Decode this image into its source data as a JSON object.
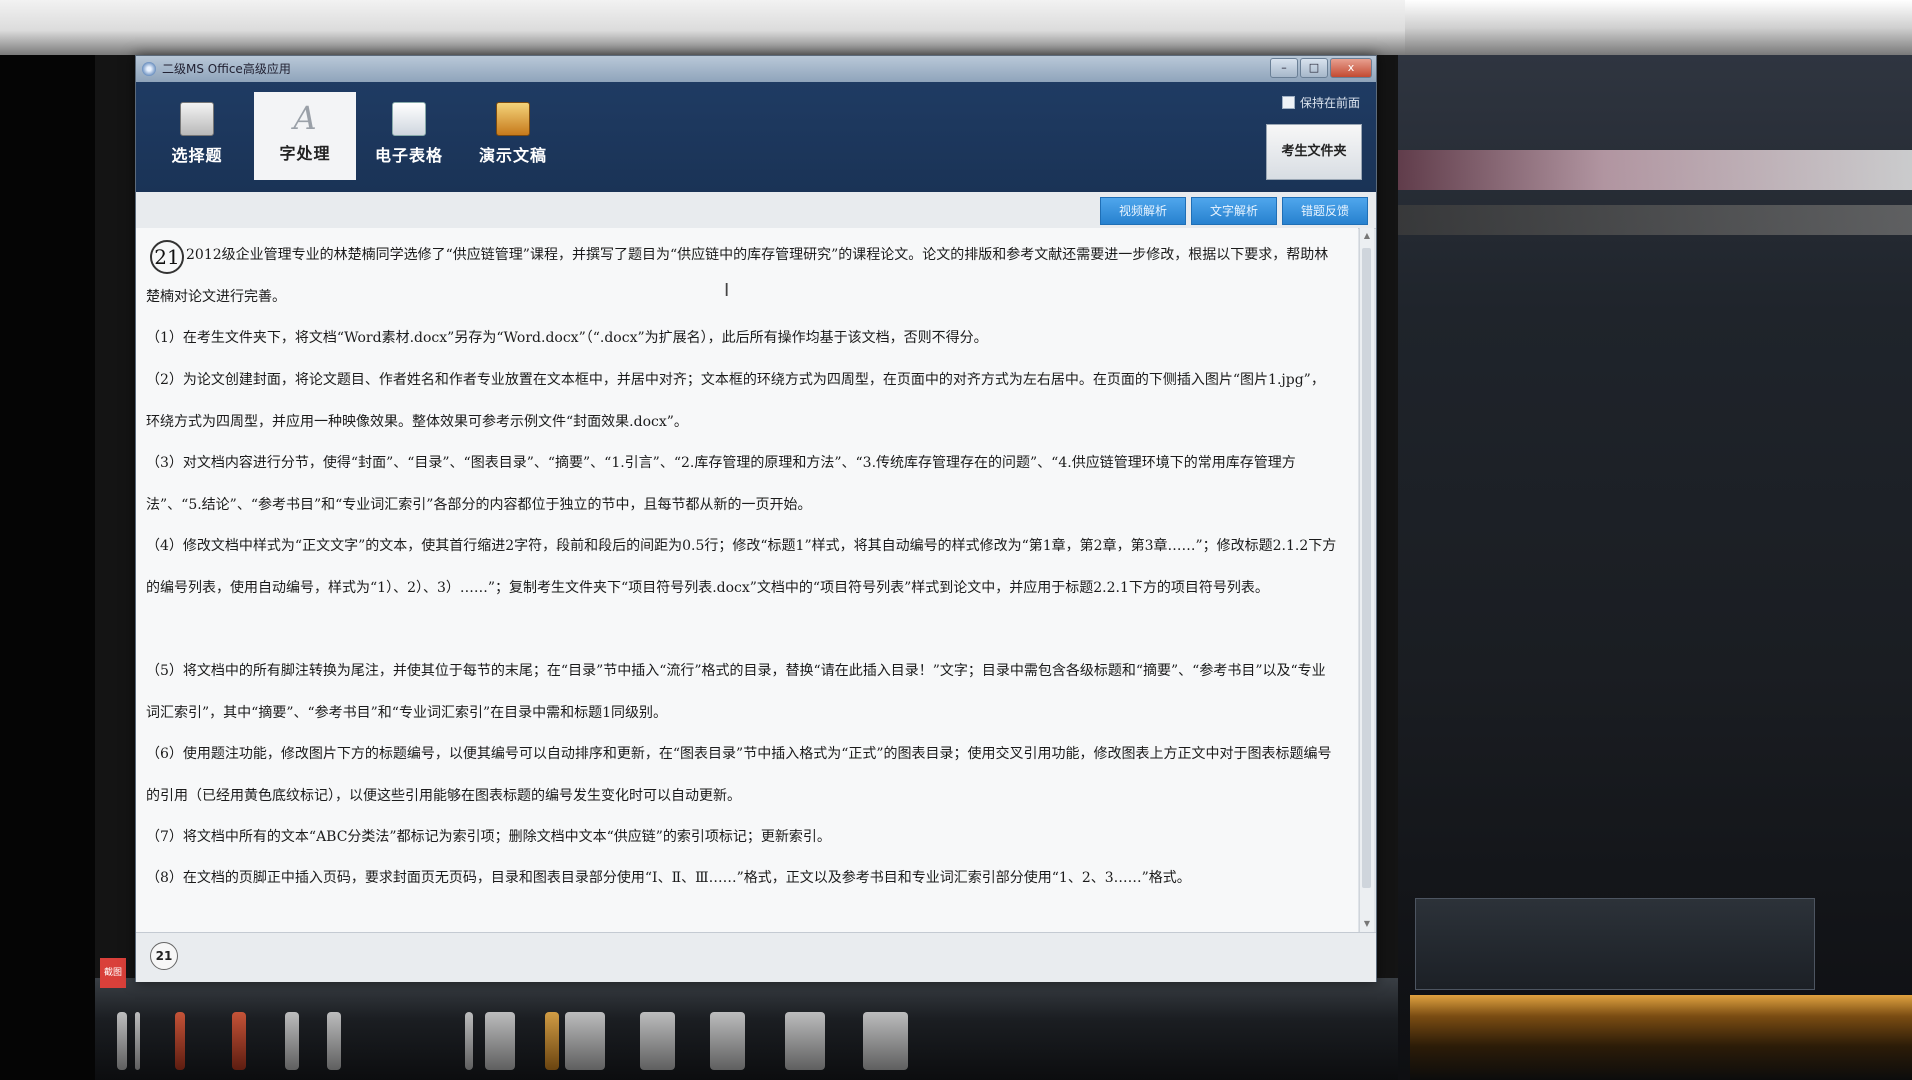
{
  "window": {
    "title": "二级MS Office高级应用",
    "btn_min": "–",
    "btn_max": "□",
    "btn_close": "x"
  },
  "tabs": [
    {
      "label": "选择题",
      "icon": "choice-icon"
    },
    {
      "label": "字处理",
      "icon": "word-icon",
      "active": true
    },
    {
      "label": "电子表格",
      "icon": "spreadsheet-icon"
    },
    {
      "label": "演示文稿",
      "icon": "presentation-icon"
    }
  ],
  "word_icon_glyph": "A",
  "keep_front_label": "保持在前面",
  "folder_button": "考生文件夹",
  "toolbar_buttons": [
    "视频解析",
    "文字解析",
    "错题反馈"
  ],
  "question": {
    "number": "21",
    "intro": "2012级企业管理专业的林楚楠同学选修了“供应链管理”课程，并撰写了题目为“供应链中的库存管理研究”的课程论文。论文的排版和参考文献还需要进一步修改，根据以下要求，帮助林楚楠对论文进行完善。",
    "items": [
      "（1）在考生文件夹下，将文档“Word素材.docx”另存为“Word.docx”（“.docx”为扩展名），此后所有操作均基于该文档，否则不得分。",
      "（2）为论文创建封面，将论文题目、作者姓名和作者专业放置在文本框中，并居中对齐；文本框的环绕方式为四周型，在页面中的对齐方式为左右居中。在页面的下侧插入图片“图片1.jpg”，环绕方式为四周型，并应用一种映像效果。整体效果可参考示例文件“封面效果.docx”。",
      "（3）对文档内容进行分节，使得“封面”、“目录”、“图表目录”、“摘要”、“1.引言”、“2.库存管理的原理和方法”、“3.传统库存管理存在的问题”、“4.供应链管理环境下的常用库存管理方法”、“5.结论”、“参考书目”和“专业词汇索引”各部分的内容都位于独立的节中，且每节都从新的一页开始。",
      "（4）修改文档中样式为“正文文字”的文本，使其首行缩进2字符，段前和段后的间距为0.5行；修改“标题1”样式，将其自动编号的样式修改为“第1章，第2章，第3章……”；修改标题2.1.2下方的编号列表，使用自动编号，样式为“1）、2）、3）……”；复制考生文件夹下“项目符号列表.docx”文档中的“项目符号列表”样式到论文中，并应用于标题2.2.1下方的项目符号列表。",
      "（5）将文档中的所有脚注转换为尾注，并使其位于每节的末尾；在“目录”节中插入“流行”格式的目录，替换“请在此插入目录！”文字；目录中需包含各级标题和“摘要”、“参考书目”以及“专业词汇索引”，其中“摘要”、“参考书目”和“专业词汇索引”在目录中需和标题1同级别。",
      "（6）使用题注功能，修改图片下方的标题编号，以便其编号可以自动排序和更新，在“图表目录”节中插入格式为“正式”的图表目录；使用交叉引用功能，修改图表上方正文中对于图表标题编号的引用（已经用黄色底纹标记），以便这些引用能够在图表标题的编号发生变化时可以自动更新。",
      "（7）将文档中所有的文本“ABC分类法”都标记为索引项；删除文档中文本“供应链”的索引项标记；更新索引。",
      "（8）在文档的页脚正中插入页码，要求封面页无页码，目录和图表目录部分使用“Ⅰ、Ⅱ、Ⅲ……”格式，正文以及参考书目和专业词汇索引部分使用“1、2、3……”格式。"
    ]
  },
  "footer_number": "21",
  "side_tab_label": "截图"
}
